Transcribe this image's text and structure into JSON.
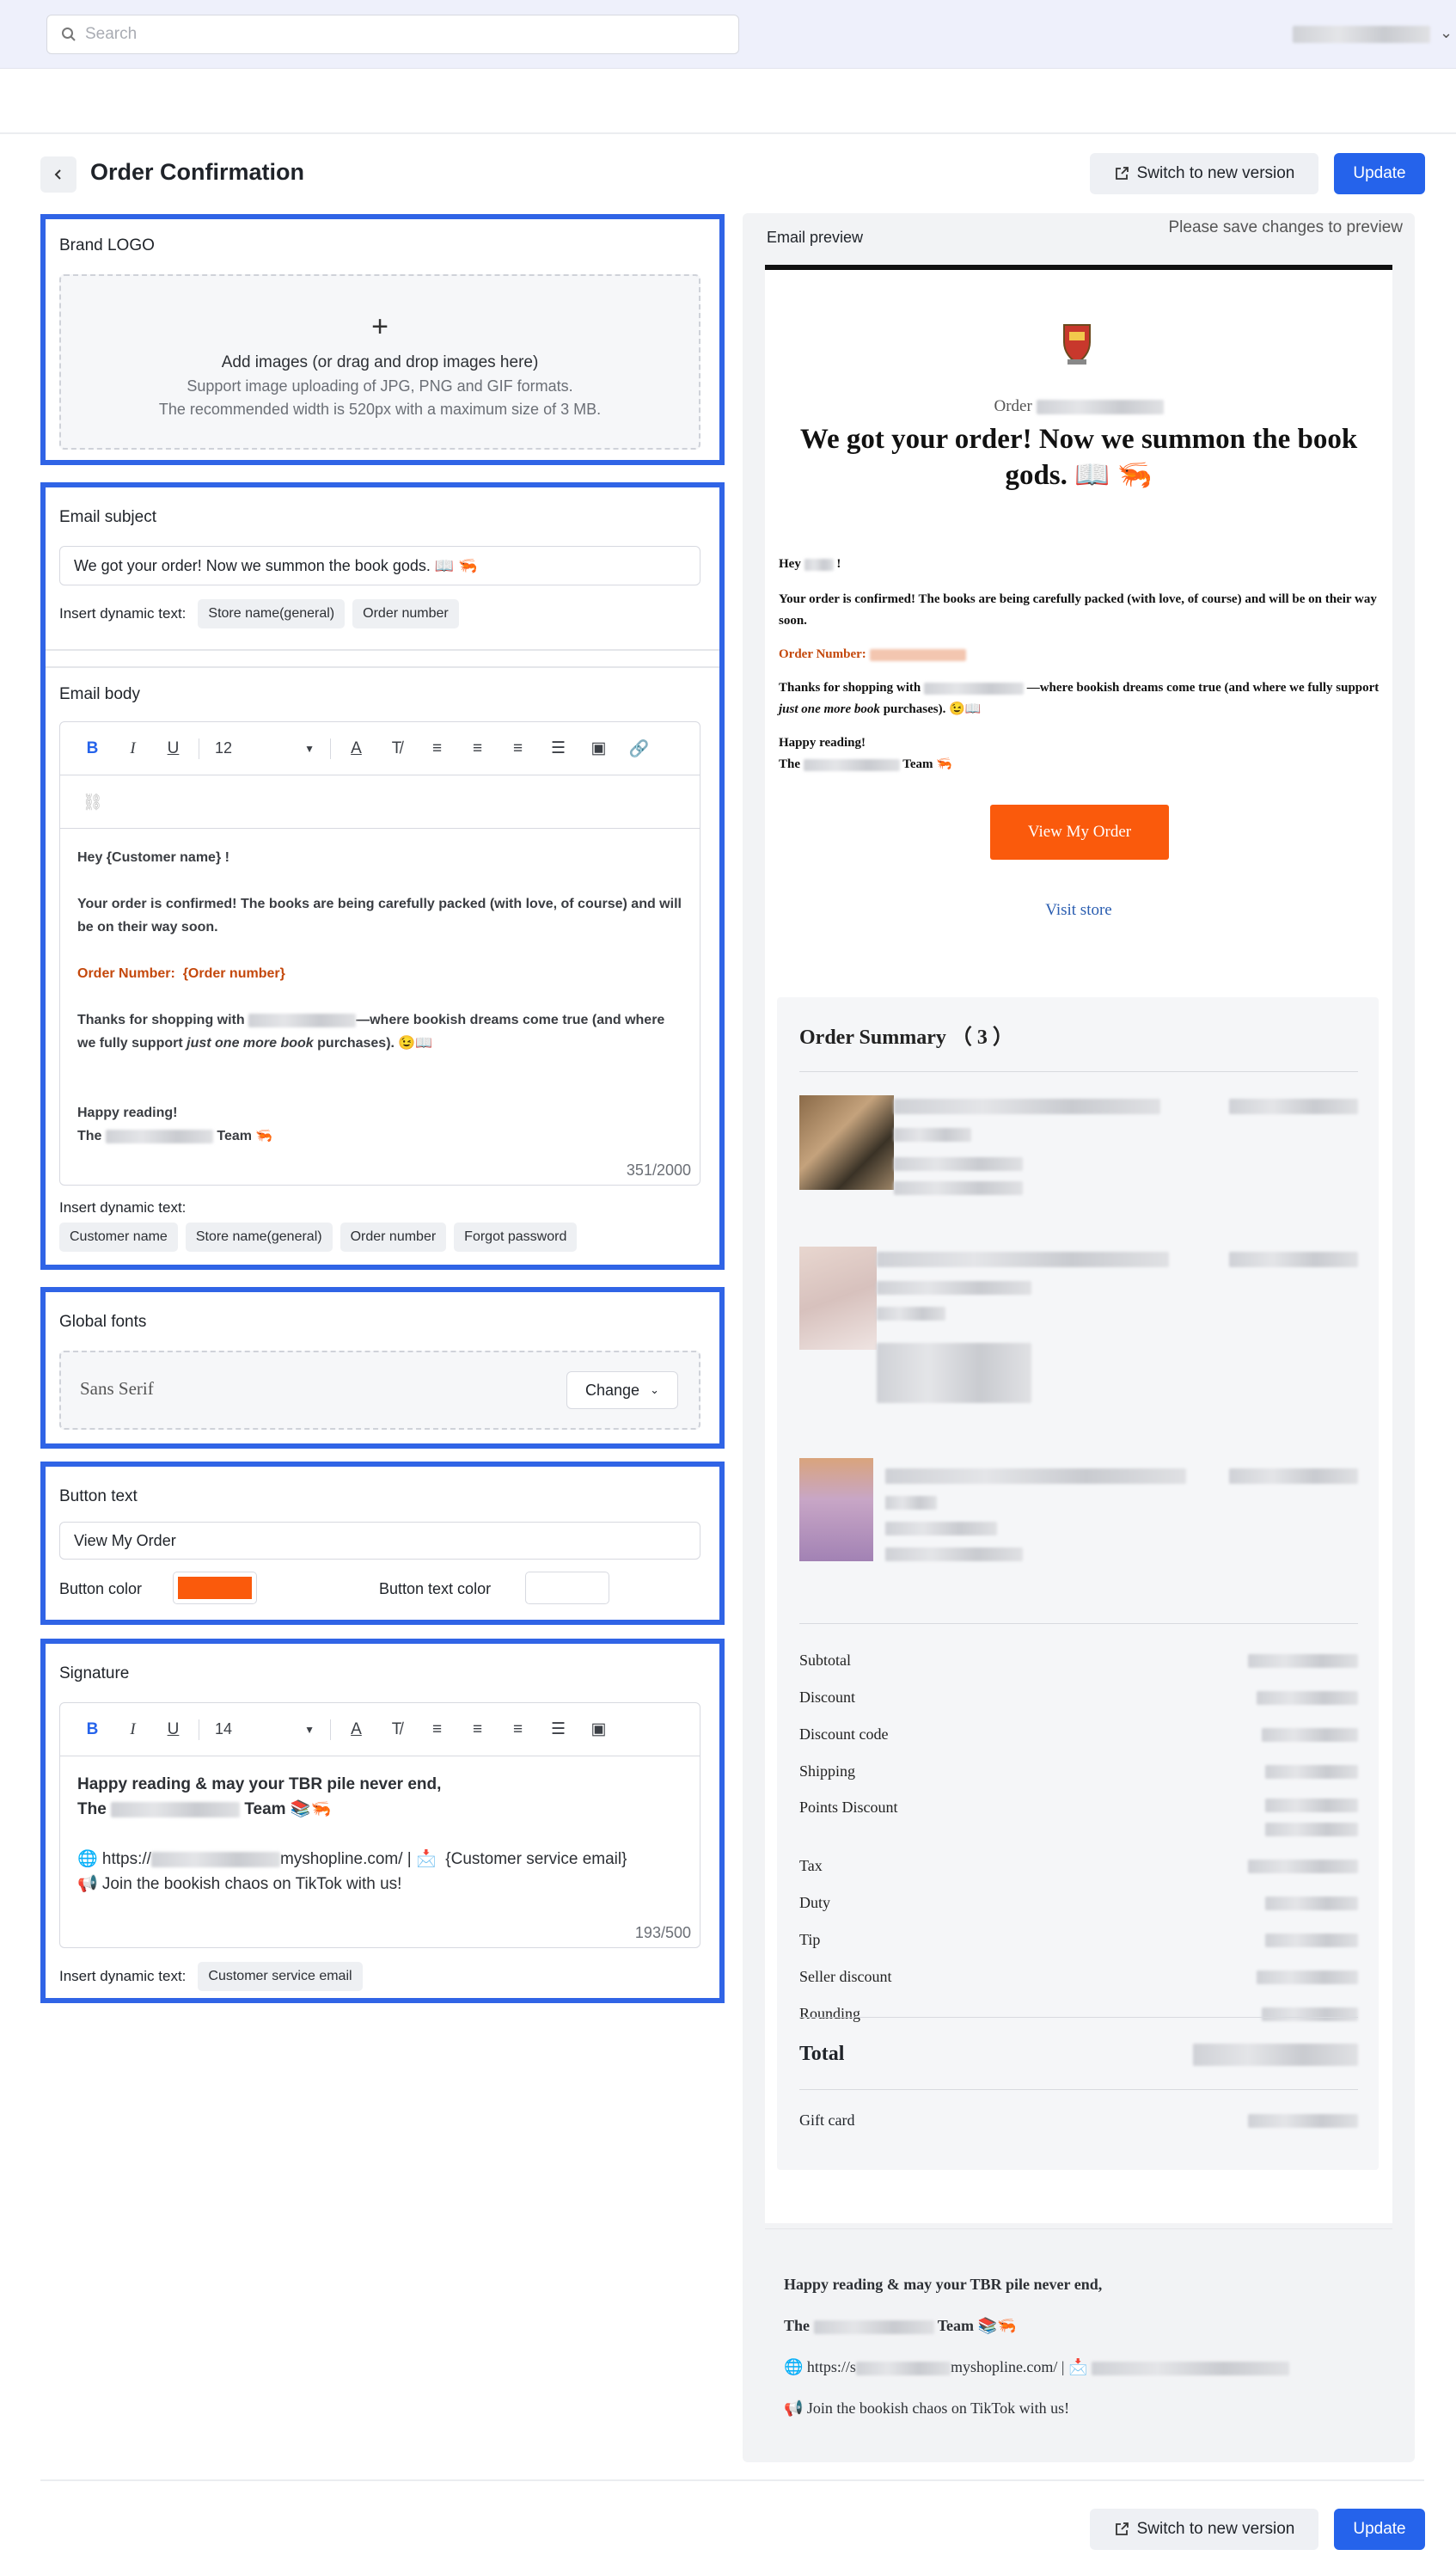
{
  "topbar": {
    "search_placeholder": "Search"
  },
  "header": {
    "title": "Order Confirmation",
    "switch_label": "Switch to new version",
    "update_label": "Update"
  },
  "brand_logo": {
    "title": "Brand LOGO",
    "add_text": "Add images (or drag and drop images here)",
    "support_text": "Support image uploading of JPG, PNG and GIF formats.",
    "width_text": "The recommended width is 520px with a maximum size of 3 MB."
  },
  "subject": {
    "title": "Email subject",
    "value": "We got your order! Now we summon the book gods. 📖 🦐",
    "insert_label": "Insert dynamic text:",
    "chips": [
      "Store name(general)",
      "Order number"
    ]
  },
  "body": {
    "title": "Email body",
    "font_size": "12",
    "line_hey": "Hey {Customer name} !",
    "line_confirmed": "Your order is confirmed! The books are being carefully packed (with love, of course) and will be on their way soon.",
    "order_number_label": "Order Number:",
    "order_number_value": "{Order number}",
    "thanks_pre": "Thanks for shopping with",
    "thanks_post": "—where bookish dreams come true (and where we fully support",
    "thanks_italic": "just one more book",
    "thanks_end": "purchases). 😉📖",
    "happy": "Happy reading!",
    "the": "The",
    "team": "Team 🦐",
    "count": "351/2000",
    "insert_label": "Insert dynamic text:",
    "chips": [
      "Customer name",
      "Store name(general)",
      "Order number",
      "Forgot password"
    ]
  },
  "fonts": {
    "title": "Global fonts",
    "current": "Sans Serif",
    "change_label": "Change"
  },
  "button": {
    "title": "Button text",
    "value": "View My Order",
    "color_label": "Button color",
    "color": "#fa5a0c",
    "text_color_label": "Button text color",
    "text_color": "#ffffff"
  },
  "signature": {
    "title": "Signature",
    "font_size": "14",
    "line1": "Happy reading & may your TBR pile never end,",
    "the": "The",
    "team": "Team 📚🦐",
    "url_pre": "🌐 https://",
    "url_post": "myshopline.com/ | 📩",
    "email_token": "{Customer service email}",
    "tiktok": "📢 Join the bookish chaos on TikTok with us!",
    "count": "193/500",
    "insert_label": "Insert dynamic text:",
    "chips": [
      "Customer service email"
    ]
  },
  "preview": {
    "title": "Email preview",
    "notice": "Please save changes to preview",
    "order_label": "Order",
    "headline": "We got your order! Now we summon the book gods. 📖 🦐",
    "hey": "Hey",
    "hey_end": "!",
    "confirmed": "Your order is confirmed! The books are being carefully packed (with love, of course) and will be on their way soon.",
    "order_number_label": "Order Number:",
    "thanks_pre": "Thanks for shopping with",
    "thanks_post": "—where bookish dreams come true (and where we fully support",
    "thanks_italic": "just one more book",
    "thanks_end": "purchases). 😉📖",
    "happy": "Happy reading!",
    "the": "The",
    "team": "Team 🦐",
    "button_label": "View My Order",
    "visit_store": "Visit store",
    "summary_title": "Order Summary （ 3 ）",
    "rows": [
      "Subtotal",
      "Discount",
      "Discount code",
      "Shipping",
      "Points Discount",
      "Tax",
      "Duty",
      "Tip",
      "Seller discount",
      "Rounding"
    ],
    "total_label": "Total",
    "gift_card": "Gift card",
    "sig_line1": "Happy reading & may your TBR pile never end,",
    "sig_the": "The",
    "sig_team": "Team 📚🦐",
    "sig_url_pre": "🌐 https://s",
    "sig_url_post": "myshopline.com/ | 📩",
    "sig_tiktok": "📢 Join the bookish chaos on TikTok with us!"
  },
  "colors": {
    "accent": "#2563eb",
    "highlight_border": "#3064e6",
    "order_orange": "#c4480c",
    "button_orange": "#fa5a0c"
  }
}
